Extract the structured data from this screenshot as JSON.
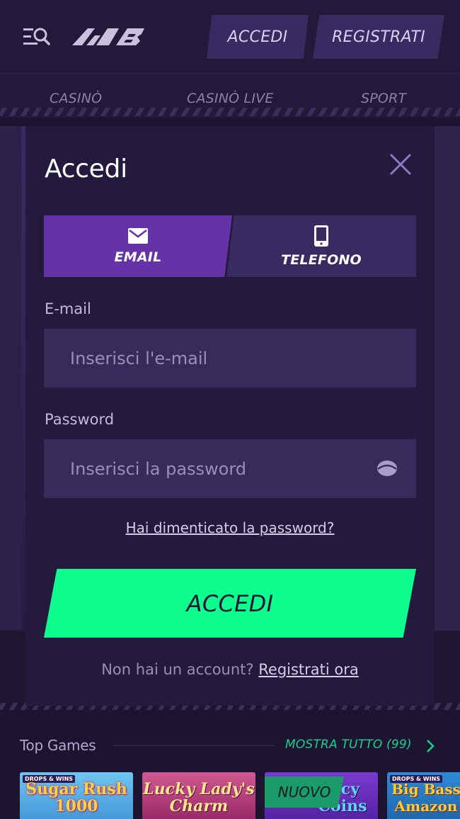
{
  "header": {
    "logo_alt": "logo",
    "login_label": "ACCEDI",
    "register_label": "REGISTRATI"
  },
  "nav": {
    "items": [
      {
        "label": "CASINÒ"
      },
      {
        "label": "CASINÒ LIVE"
      },
      {
        "label": "SPORT"
      }
    ]
  },
  "modal": {
    "title": "Accedi",
    "tabs": [
      {
        "label": "EMAIL",
        "icon": "envelope-icon",
        "active": true
      },
      {
        "label": "TELEFONO",
        "icon": "smartphone-icon",
        "active": false
      }
    ],
    "email": {
      "label": "E-mail",
      "placeholder": "Inserisci l'e-mail",
      "value": ""
    },
    "password": {
      "label": "Password",
      "placeholder": "Inserisci la password",
      "value": ""
    },
    "forgot_label": "Hai dimenticato la password?",
    "submit_label": "ACCEDI",
    "no_account_text": "Non hai un account?",
    "signup_link": "Registrati ora"
  },
  "top_games": {
    "title": "Top Games",
    "show_all": "MOSTRA TUTTO (99)",
    "new_badge": "NUOVO",
    "cards": [
      {
        "name": "Sugar Rush 1000",
        "badge": "DROPS & WINS"
      },
      {
        "name": "Lucky Lady's Charm",
        "badge": ""
      },
      {
        "name": "…cy Coins",
        "badge": ""
      },
      {
        "name": "Big Bass Amazon",
        "badge": "DROPS & WINS"
      }
    ]
  },
  "colors": {
    "background": "#1c1430",
    "modal": "#241a3d",
    "tab_active": "#6532a8",
    "tab_inactive": "#3a2a62",
    "input": "#382a5b",
    "accent_green": "#0dfd8f",
    "link_green": "#1ad08a"
  }
}
